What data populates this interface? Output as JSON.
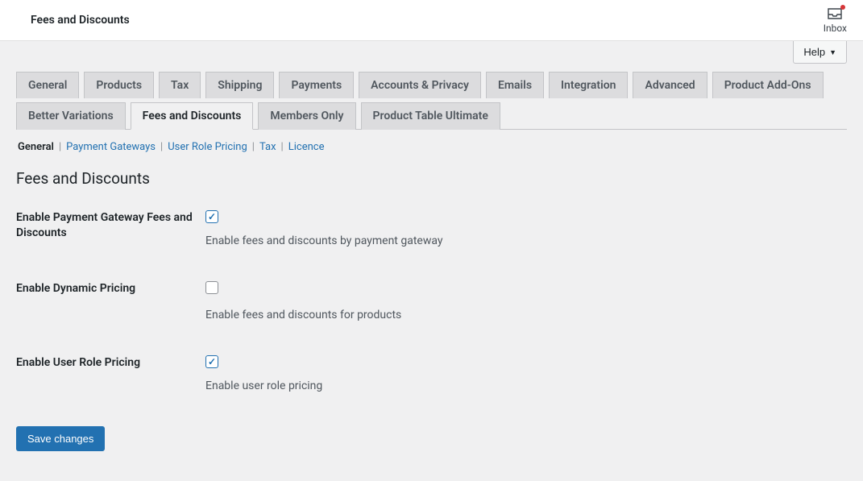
{
  "topbar": {
    "title": "Fees and Discounts",
    "inbox_label": "Inbox"
  },
  "help": {
    "label": "Help"
  },
  "tabs": {
    "row1": [
      "General",
      "Products",
      "Tax",
      "Shipping",
      "Payments",
      "Accounts & Privacy",
      "Emails",
      "Integration",
      "Advanced",
      "Product Add-Ons"
    ],
    "row2": [
      "Better Variations",
      "Fees and Discounts",
      "Members Only",
      "Product Table Ultimate"
    ],
    "active": "Fees and Discounts"
  },
  "subnav": {
    "items": [
      "General",
      "Payment Gateways",
      "User Role Pricing",
      "Tax",
      "Licence"
    ],
    "current": "General"
  },
  "section_title": "Fees and Discounts",
  "settings": [
    {
      "label": "Enable Payment Gateway Fees and Discounts",
      "checked": true,
      "desc": "Enable fees and discounts by payment gateway",
      "name": "enable-payment-gateway-fees"
    },
    {
      "label": "Enable Dynamic Pricing",
      "checked": false,
      "desc": "Enable fees and discounts for products",
      "name": "enable-dynamic-pricing"
    },
    {
      "label": "Enable User Role Pricing",
      "checked": true,
      "desc": "Enable user role pricing",
      "name": "enable-user-role-pricing"
    }
  ],
  "save_label": "Save changes"
}
